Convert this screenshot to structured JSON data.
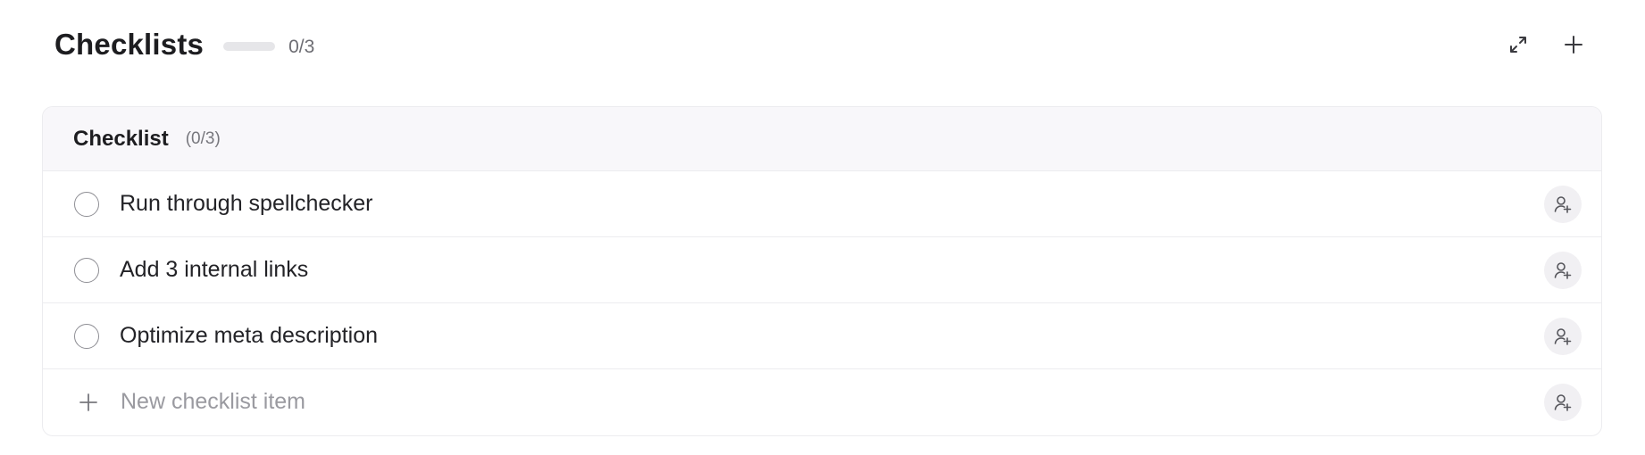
{
  "header": {
    "title": "Checklists",
    "progress_text": "0/3",
    "progress_fraction": 0,
    "expand_icon": "expand-icon",
    "add_icon": "plus-icon"
  },
  "checklist": {
    "title": "Checklist",
    "count": "(0/3)",
    "items": [
      {
        "label": "Run through spellchecker",
        "checked": false
      },
      {
        "label": "Add 3 internal links",
        "checked": false
      },
      {
        "label": "Optimize meta description",
        "checked": false
      }
    ],
    "new_item_placeholder": "New checklist item",
    "assign_icon": "assign-user-icon"
  },
  "colors": {
    "accent": "#7b7bd6",
    "border": "#ececef",
    "header_bg": "#f8f7fa"
  }
}
